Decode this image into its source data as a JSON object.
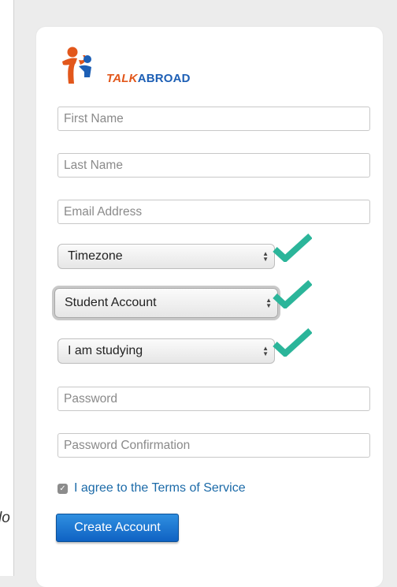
{
  "edge_text": "lo",
  "brand": {
    "part1": "TALK",
    "part2": "ABROAD"
  },
  "form": {
    "first_name_placeholder": "First Name",
    "last_name_placeholder": "Last Name",
    "email_placeholder": "Email Address",
    "timezone_value": "Timezone",
    "account_type_value": "Student Account",
    "studying_value": "I am studying",
    "password_placeholder": "Password",
    "password_confirmation_placeholder": "Password Confirmation",
    "terms_label": "I agree to the Terms of Service",
    "terms_checked": true,
    "submit_label": "Create Account"
  },
  "icons": {
    "logo": "people-logo-icon",
    "valid": "checkmark-icon",
    "select_arrows": "updown-arrows-icon",
    "checkbox": "checkbox-checked-icon"
  },
  "colors": {
    "accent_blue": "#1268c9",
    "brand_orange": "#e2571b",
    "brand_blue": "#1d5fb5",
    "check_green": "#2bb59a",
    "link": "#1b6aa8"
  }
}
